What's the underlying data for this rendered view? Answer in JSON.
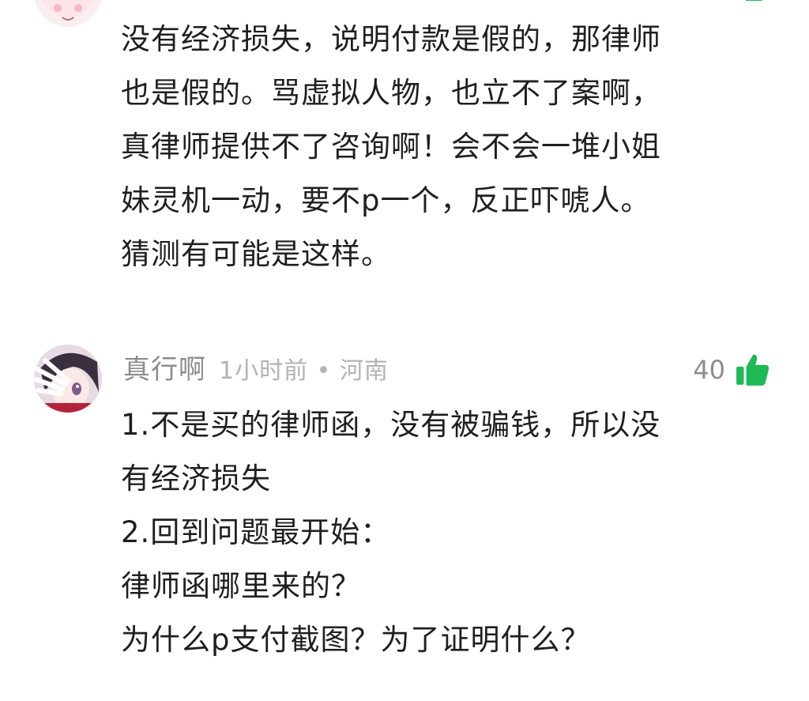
{
  "colors": {
    "like_green": "#1db954",
    "text_primary": "#1f1f1f",
    "text_secondary": "#8c8c8c",
    "text_tertiary": "#b3b3b3"
  },
  "comments": [
    {
      "avatar_icon": "avatar-anime-girl",
      "like_icon": "thumbs-up-icon",
      "lines": [
        "没有经济损失，说明付款是假的，那律师",
        "也是假的。骂虚拟人物，也立不了案啊，",
        "真律师提供不了咨询啊！会不会一堆小姐",
        "妹灵机一动，要不p一个，反正吓唬人。",
        "猜测有可能是这样。"
      ]
    },
    {
      "avatar_icon": "avatar-anime-girl",
      "username": "真行啊",
      "time_location": "1小时前 • 河南",
      "likes": "40",
      "like_icon": "thumbs-up-icon",
      "lines": [
        "1.不是买的律师函，没有被骗钱，所以没",
        "有经济损失",
        "2.回到问题最开始：",
        "律师函哪里来的？",
        "为什么p支付截图？为了证明什么？"
      ]
    }
  ]
}
